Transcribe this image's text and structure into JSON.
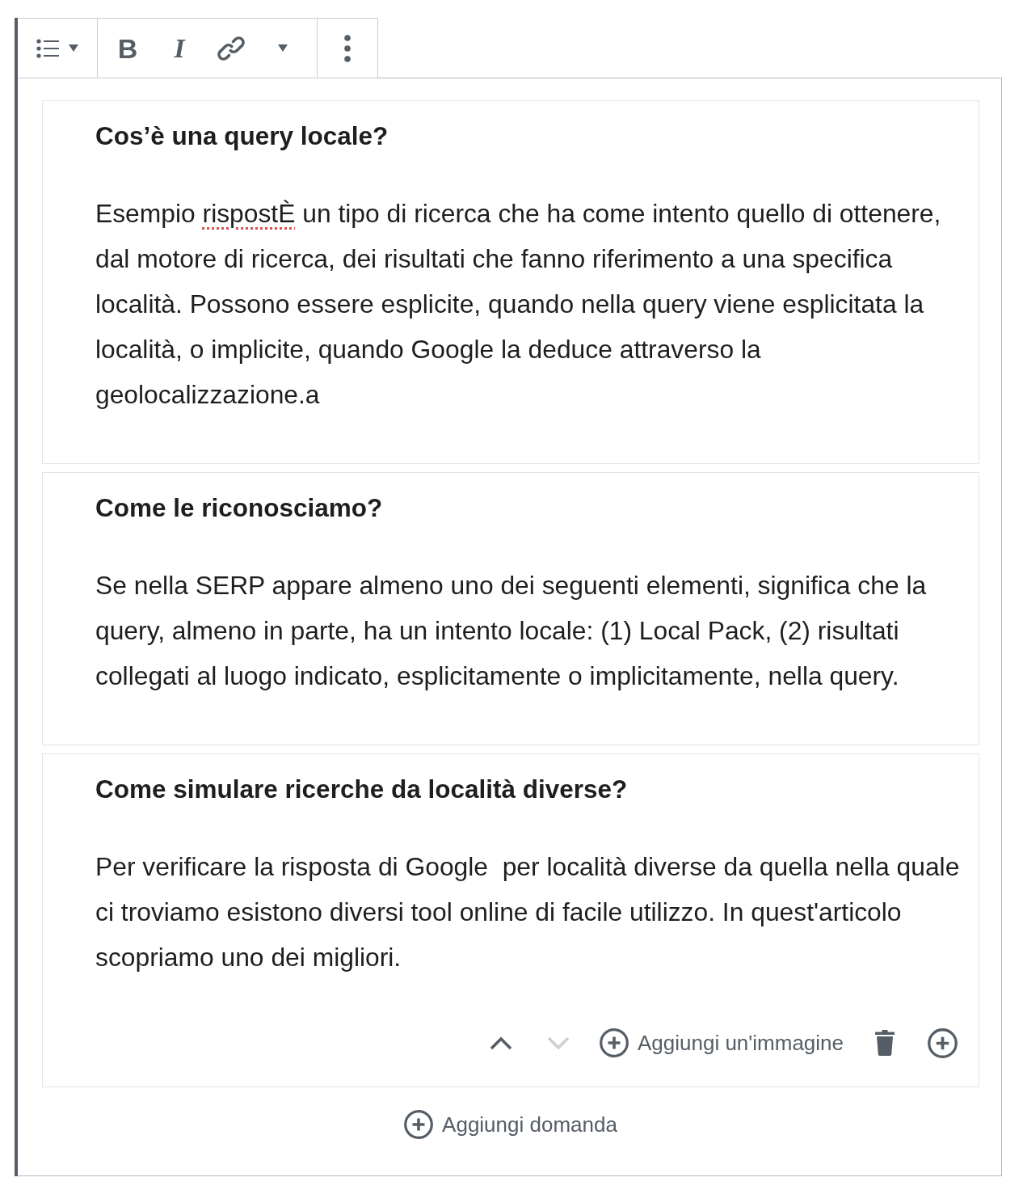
{
  "toolbar": {
    "groups": [
      {
        "items": [
          {
            "kind": "list-style"
          }
        ]
      },
      {
        "items": [
          {
            "kind": "bold",
            "label": "B"
          },
          {
            "kind": "italic",
            "label": "I"
          },
          {
            "kind": "link"
          },
          {
            "kind": "more-formats"
          }
        ]
      },
      {
        "items": [
          {
            "kind": "more-options"
          }
        ]
      }
    ]
  },
  "questions": [
    {
      "question": "Cos’è una query locale?",
      "answer": [
        {
          "text": "Esempio ",
          "misspelled": false
        },
        {
          "text": "rispostÈ",
          "misspelled": true
        },
        {
          "text": " un tipo di ricerca che ha come intento quello di ottenere, dal motore di ricerca, dei risultati che fanno riferimento a una specifica località. Possono essere esplicite, quando nella query viene esplicitata la località, o implicite, quando Google la deduce attraverso la geolocalizzazione.a",
          "misspelled": false
        }
      ]
    },
    {
      "question": "Come le riconosciamo?",
      "answer": [
        {
          "text": "Se nella SERP appare almeno uno dei seguenti elementi, significa che la query, almeno in parte, ha un intento locale: (1) Local Pack, (2) risultati collegati al luogo indicato, esplicitamente o implicitamente, nella query.",
          "misspelled": false
        }
      ]
    },
    {
      "question": "Come simulare ricerche da località diverse?",
      "answer": [
        {
          "text": "Per verificare la risposta di Google  per località diverse da quella nella quale ci troviamo esistono diversi tool online di facile utilizzo. In quest'articolo scopriamo uno dei migliori.",
          "misspelled": false
        }
      ],
      "actions": [
        {
          "kind": "move-up",
          "disabled": false
        },
        {
          "kind": "move-down",
          "disabled": true
        },
        {
          "kind": "add-image",
          "label": "Aggiungi un'immagine"
        },
        {
          "kind": "delete"
        },
        {
          "kind": "add"
        }
      ]
    }
  ],
  "add_question": "Aggiungi domanda"
}
